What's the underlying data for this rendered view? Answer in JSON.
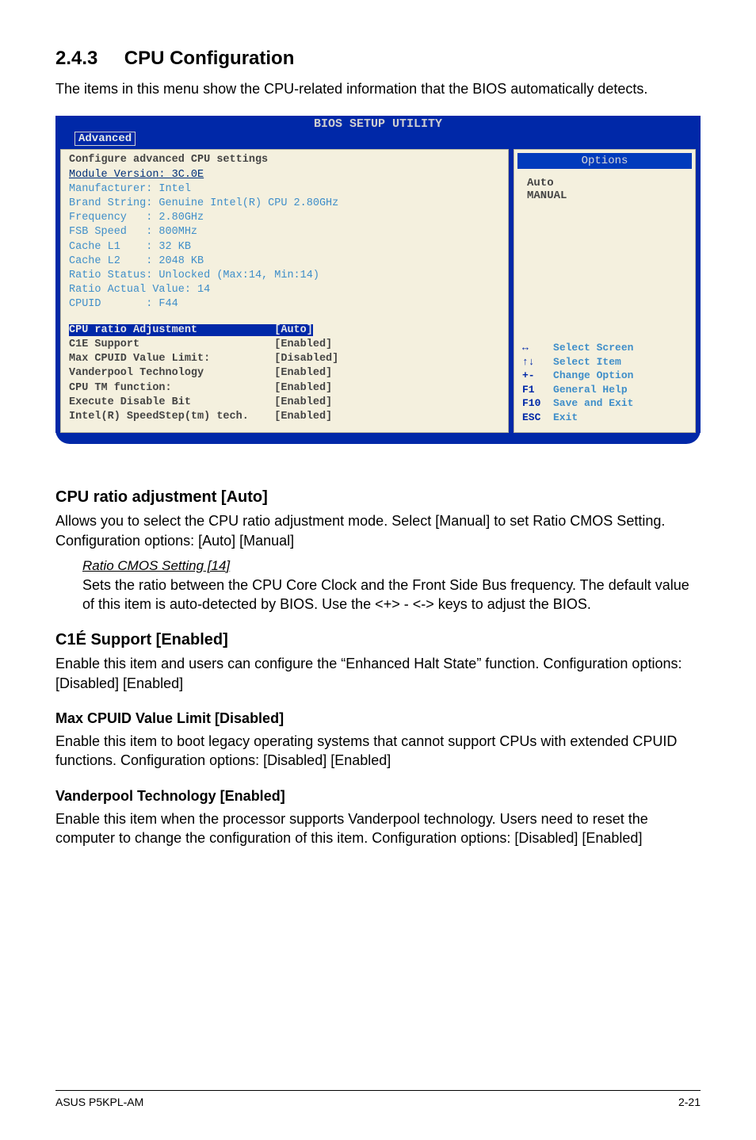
{
  "section": {
    "number": "2.4.3",
    "title": "CPU Configuration",
    "intro": "The items in this menu show the CPU-related information that the BIOS automatically detects."
  },
  "bios": {
    "title": "BIOS SETUP UTILITY",
    "tab": "Advanced",
    "header_line1": "Configure advanced CPU settings",
    "header_line2": "Module Version: 3C.0E",
    "info": "Manufacturer: Intel\nBrand String: Genuine Intel(R) CPU 2.80GHz\nFrequency   : 2.80GHz\nFSB Speed   : 800MHz\nCache L1    : 32 KB\nCache L2    : 2048 KB\nRatio Status: Unlocked (Max:14, Min:14)\nRatio Actual Value: 14\nCPUID       : F44",
    "settings": [
      {
        "label": "CPU ratio Adjustment",
        "value": "[Auto]",
        "highlight": true
      },
      {
        "label": "C1E Support",
        "value": "[Enabled]",
        "highlight": false
      },
      {
        "label": "Max CPUID Value Limit:",
        "value": "[Disabled]",
        "highlight": false
      },
      {
        "label": "Vanderpool Technology",
        "value": "[Enabled]",
        "highlight": false
      },
      {
        "label": "CPU TM function:",
        "value": "[Enabled]",
        "highlight": false
      },
      {
        "label": "Execute Disable Bit",
        "value": "[Enabled]",
        "highlight": false
      },
      {
        "label": "Intel(R) SpeedStep(tm) tech.",
        "value": "[Enabled]",
        "highlight": false
      }
    ],
    "options_header": "Options",
    "options": [
      "Auto",
      "MANUAL"
    ],
    "help": [
      {
        "key": "↔",
        "text": "Select Screen"
      },
      {
        "key": "↑↓",
        "text": "Select Item"
      },
      {
        "key": "+-",
        "text": "Change Option"
      },
      {
        "key": "F1",
        "text": "General Help"
      },
      {
        "key": "F10",
        "text": "Save and Exit"
      },
      {
        "key": "ESC",
        "text": "Exit"
      }
    ]
  },
  "descriptions": {
    "cpu_ratio": {
      "heading": "CPU ratio adjustment [Auto]",
      "body": "Allows you to select the CPU ratio adjustment mode. Select [Manual] to set Ratio CMOS Setting. Configuration options: [Auto] [Manual]",
      "sub_title": "Ratio CMOS Setting [14]",
      "sub_body": "Sets the ratio between the CPU Core Clock and the Front Side Bus frequency. The default value of this item is auto-detected by BIOS. Use the <+> - <-> keys to adjust the BIOS."
    },
    "c1e": {
      "heading": "C1É Support [Enabled]",
      "body": "Enable this item and users can configure the “Enhanced Halt State” function. Configuration options: [Disabled] [Enabled]"
    },
    "max_cpuid": {
      "heading": "Max CPUID Value Limit [Disabled]",
      "body": "Enable this item to boot legacy operating systems that cannot support CPUs with extended CPUID functions. Configuration options: [Disabled] [Enabled]"
    },
    "vanderpool": {
      "heading": "Vanderpool Technology [Enabled]",
      "body": "Enable this item when the processor supports Vanderpool technology. Users need to reset the computer to change the configuration of this item. Configuration options: [Disabled] [Enabled]"
    }
  },
  "footer": {
    "left": "ASUS P5KPL-AM",
    "right": "2-21"
  }
}
